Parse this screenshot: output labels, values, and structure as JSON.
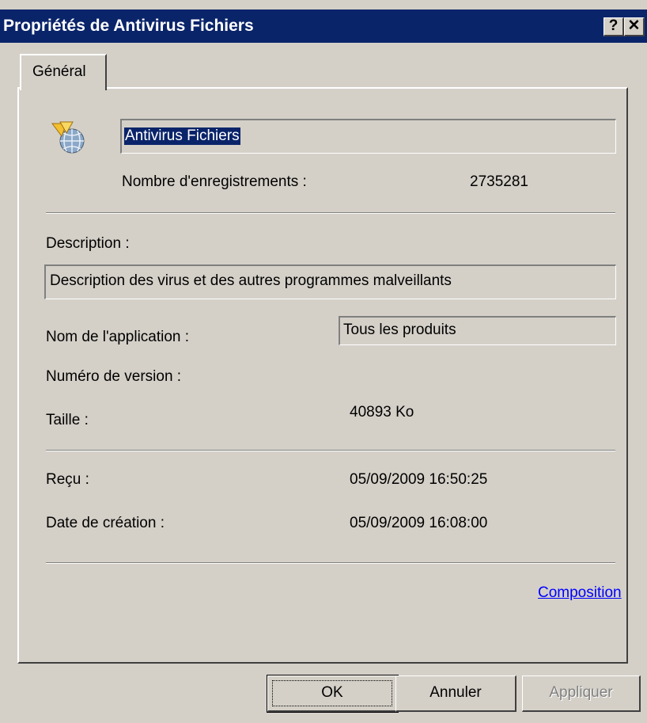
{
  "window": {
    "title": "Propriétés de Antivirus Fichiers",
    "help_label": "?",
    "close_label": "✕"
  },
  "tabs": [
    {
      "label": "Général",
      "active": true
    }
  ],
  "general": {
    "name_value": "Antivirus Fichiers",
    "records_label": "Nombre d'enregistrements :",
    "records_value": "2735281",
    "description_label": "Description :",
    "description_value": "Description des virus et des autres programmes malveillants",
    "app_name_label": "Nom de l'application :",
    "app_name_value": "Tous les produits",
    "version_label": "Numéro de version :",
    "version_value": "",
    "size_label": "Taille :",
    "size_value": "40893 Ko",
    "received_label": "Reçu :",
    "received_value": "05/09/2009 16:50:25",
    "created_label": "Date de création :",
    "created_value": "05/09/2009 16:08:00",
    "composition_link": "Composition"
  },
  "buttons": {
    "ok": "OK",
    "cancel": "Annuler",
    "apply": "Appliquer"
  },
  "colors": {
    "titlebar": "#0a246a",
    "face": "#d4d0c8",
    "selection": "#0a246a",
    "link": "#0000ff"
  }
}
